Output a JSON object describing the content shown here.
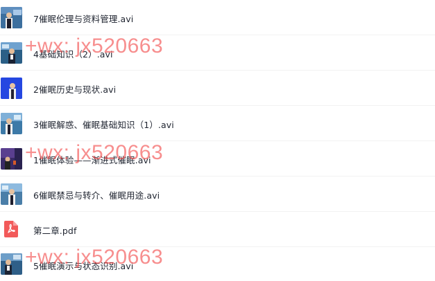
{
  "files": [
    {
      "name": "7催眠伦理与资料管理.avi",
      "type": "video"
    },
    {
      "name": "4基础知识（2）.avi",
      "type": "video"
    },
    {
      "name": "2催眠历史与现状.avi",
      "type": "video"
    },
    {
      "name": "3催眠解惑、催眠基础知识（1）.avi",
      "type": "video"
    },
    {
      "name": "1催眠体验——渐进式催眠.avi",
      "type": "video"
    },
    {
      "name": "6催眠禁忌与转介、催眠用途.avi",
      "type": "video"
    },
    {
      "name": "第二章.pdf",
      "type": "pdf"
    },
    {
      "name": "5催眠演示与状态识别.avi",
      "type": "video"
    }
  ],
  "watermark": "+wx: jx520663",
  "colors": {
    "watermark": "#f24848",
    "pdf_icon": "#f25a5a",
    "text": "#1f2430"
  }
}
